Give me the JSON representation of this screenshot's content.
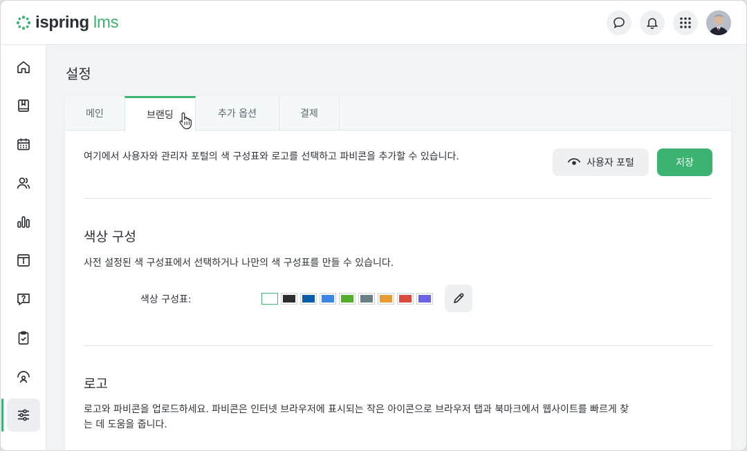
{
  "app": {
    "logo_text_main": "ispring",
    "logo_text_accent": "lms",
    "brand_color": "#3cb371"
  },
  "header": {
    "icons": [
      "chat-icon",
      "bell-icon",
      "apps-grid-icon"
    ],
    "avatar": "user-avatar"
  },
  "sidebar": {
    "items": [
      {
        "icon": "home-icon",
        "active": false
      },
      {
        "icon": "book-icon",
        "active": false
      },
      {
        "icon": "calendar-icon",
        "active": false
      },
      {
        "icon": "users-icon",
        "active": false
      },
      {
        "icon": "bar-chart-icon",
        "active": false
      },
      {
        "icon": "info-panel-icon",
        "active": false
      },
      {
        "icon": "question-chat-icon",
        "active": false
      },
      {
        "icon": "clipboard-check-icon",
        "active": false
      },
      {
        "icon": "speedometer-user-icon",
        "active": false
      },
      {
        "icon": "sliders-icon",
        "active": true
      }
    ]
  },
  "page": {
    "title": "설정",
    "tabs": [
      {
        "label": "메인",
        "active": false
      },
      {
        "label": "브랜딩",
        "active": true
      },
      {
        "label": "추가 옵션",
        "active": false
      },
      {
        "label": "결제",
        "active": false
      }
    ],
    "intro": "여기에서 사용자와 관리자 포털의 색 구성표와 로고를 선택하고 파비콘을 추가할 수 있습니다.",
    "portal_button": "사용자 포털",
    "save_button": "저장",
    "color_section": {
      "title": "색상 구성",
      "description": "사전 설정된 색 구성표에서 선택하거나 나만의 색 구성표를 만들 수 있습니다.",
      "label": "색상 구성표:",
      "swatches": [
        "#ffffff",
        "#2b2d31",
        "#0b5cad",
        "#3c86e8",
        "#55ad2c",
        "#6b7f87",
        "#e89a35",
        "#d94b3d",
        "#6c63e6"
      ],
      "selected_index": 0
    },
    "logo_section": {
      "title": "로고",
      "description_line1": "로고와 파비콘을 업로드하세요. 파비콘은 인터넷 브라우저에 표시되는 작은 아이콘으로 브라우저 탭과 북마크에서 웹사이트를 빠르게 찾",
      "description_line2": "는 데 도움을 줍니다."
    }
  }
}
